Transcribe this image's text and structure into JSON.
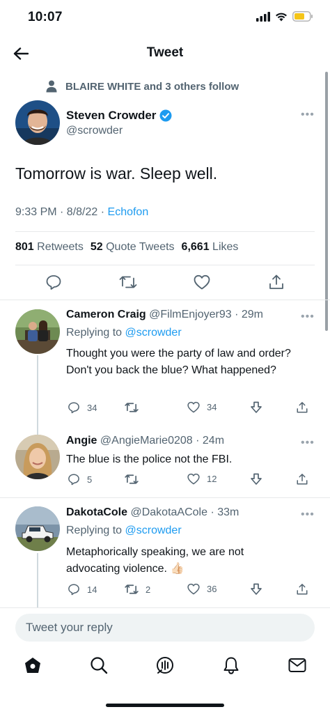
{
  "status_bar": {
    "time": "10:07"
  },
  "nav": {
    "title": "Tweet"
  },
  "social_context": "BLAIRE WHITE and 3 others follow",
  "tweet": {
    "author_name": "Steven Crowder",
    "author_handle": "@scrowder",
    "text": "Tomorrow is war. Sleep well.",
    "timestamp": "9:33 PM · 8/8/22 · ",
    "source": "Echofon",
    "stats": {
      "retweets_count": "801",
      "retweets_label": "Retweets",
      "quotes_count": "52",
      "quotes_label": "Quote Tweets",
      "likes_count": "6,661",
      "likes_label": "Likes"
    }
  },
  "replies": [
    {
      "name": "Cameron Craig",
      "handle": "@FilmEnjoyer93 · 29m",
      "replying_prefix": "Replying to ",
      "replying_to": "@scrowder",
      "text": "Thought you were the party of law and order? Don't you back the blue? What happened?",
      "reply_count": "34",
      "retweet_count": "",
      "like_count": "34"
    },
    {
      "name": "Angie",
      "handle": "@AngieMarie0208 · 24m",
      "text": "The blue is the police not the FBI.",
      "reply_count": "5",
      "retweet_count": "",
      "like_count": "12"
    },
    {
      "name": "DakotaCole",
      "handle": "@DakotaACole · 33m",
      "replying_prefix": "Replying to ",
      "replying_to": "@scrowder",
      "text": "Metaphorically speaking, we are not advocating violence.",
      "emoji": "👍🏻",
      "reply_count": "14",
      "retweet_count": "2",
      "like_count": "36"
    }
  ],
  "composer": {
    "placeholder": "Tweet your reply"
  },
  "colors": {
    "accent": "#1d9bf0",
    "text": "#0f1419",
    "secondary": "#536471",
    "divider": "#e7e9ea",
    "battery": "#f5c518"
  },
  "icons": [
    "back-arrow-icon",
    "person-icon",
    "verified-badge-icon",
    "reply-icon",
    "retweet-icon",
    "like-icon",
    "share-icon",
    "downvote-icon",
    "home-icon",
    "search-icon",
    "spaces-icon",
    "notifications-icon",
    "messages-icon"
  ]
}
